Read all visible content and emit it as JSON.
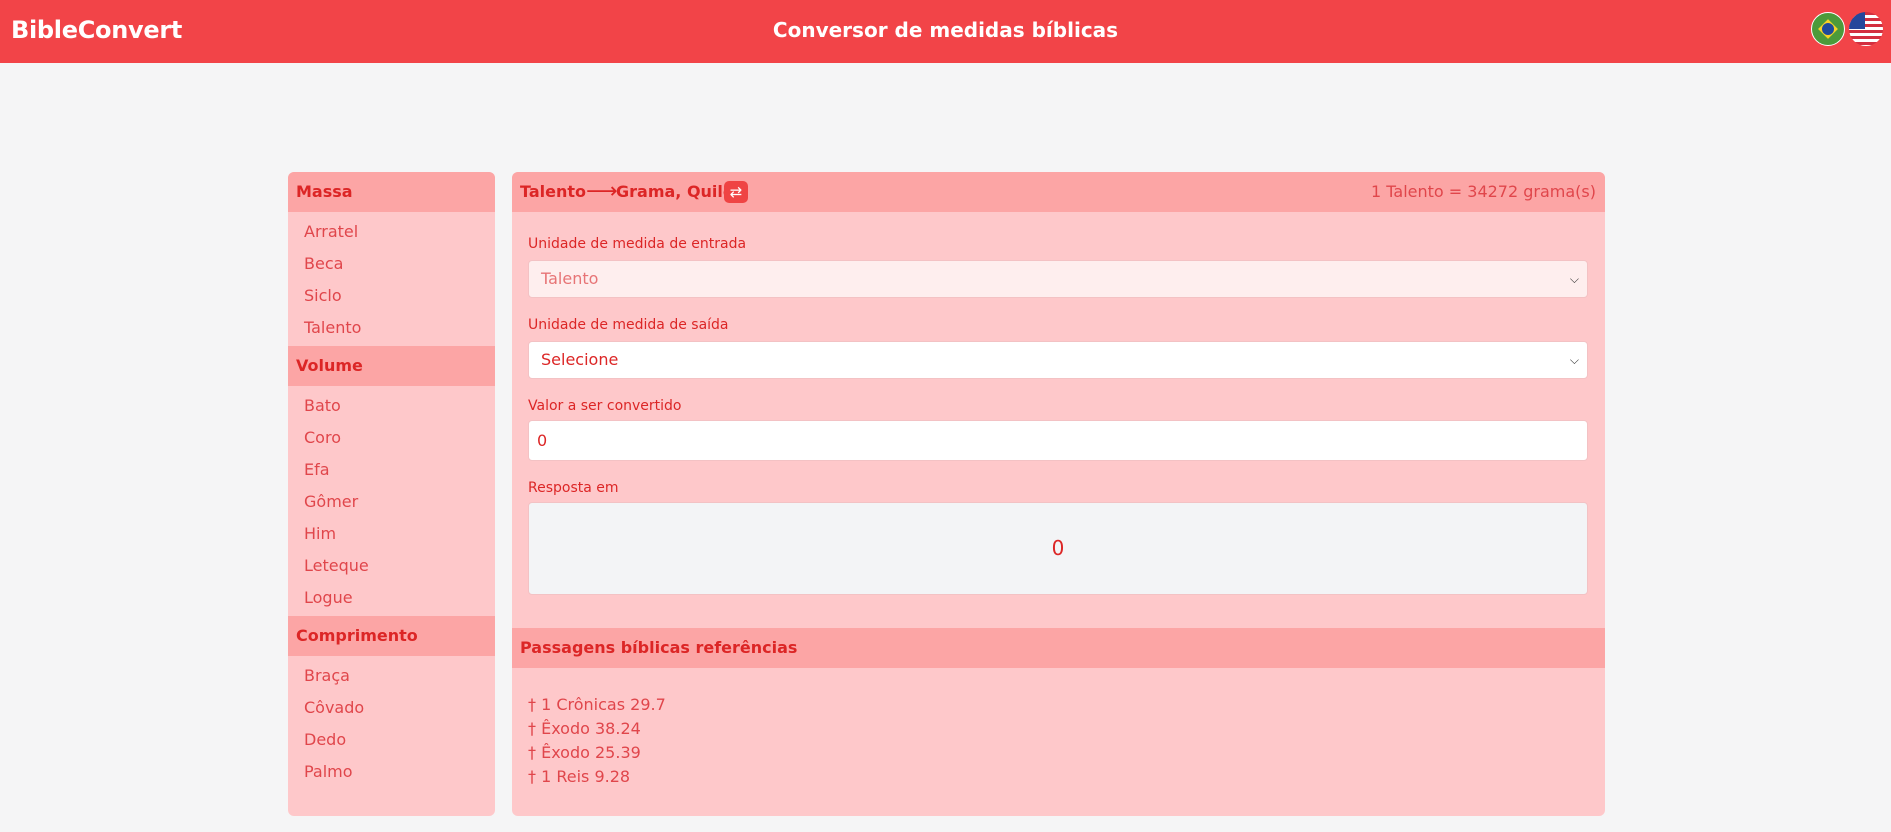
{
  "header": {
    "brand": "BibleConvert",
    "title": "Conversor de medidas bíblicas",
    "languages": [
      {
        "code": "pt-BR",
        "icon": "brazil-flag-icon"
      },
      {
        "code": "en-US",
        "icon": "usa-flag-icon"
      }
    ]
  },
  "sidebar": {
    "groups": [
      {
        "title": "Massa",
        "items": [
          "Arratel",
          "Beca",
          "Siclo",
          "Talento"
        ]
      },
      {
        "title": "Volume",
        "items": [
          "Bato",
          "Coro",
          "Efa",
          "Gômer",
          "Him",
          "Leteque",
          "Logue"
        ]
      },
      {
        "title": "Comprimento",
        "items": [
          "Braça",
          "Côvado",
          "Dedo",
          "Palmo"
        ]
      }
    ]
  },
  "converter": {
    "from_unit": "Talento",
    "arrow": "⟶",
    "to_units": "Grama, Quilo",
    "swap_icon": "swap-arrows-icon",
    "ratio": "1 Talento = 34272 grama(s)",
    "input_unit_label": "Unidade de medida de entrada",
    "input_unit_value": "Talento",
    "output_unit_label": "Unidade de medida de saída",
    "output_unit_value": "Selecione",
    "value_label": "Valor a ser convertido",
    "value": "0",
    "result_label": "Resposta em",
    "result": "0"
  },
  "references": {
    "title": "Passagens bíblicas referências",
    "items": [
      "† 1 Crônicas 29.7",
      "† Êxodo 38.24",
      "† Êxodo 25.39",
      "† 1 Reis 9.28"
    ]
  },
  "colors": {
    "header_bg": "#f24448",
    "panel_bg": "#fec8ca",
    "section_header_bg": "#fca5a5",
    "accent_text": "#dc2626"
  }
}
